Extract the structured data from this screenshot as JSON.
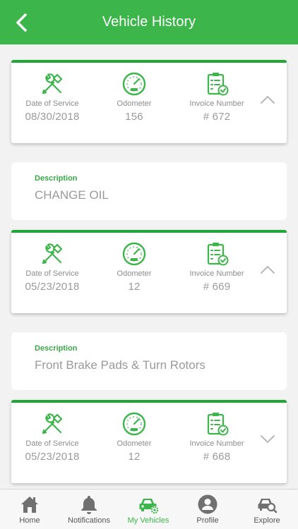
{
  "header": {
    "title": "Vehicle History"
  },
  "labels": {
    "date": "Date of Service",
    "odometer": "Odometer",
    "invoice": "Invoice Number",
    "description": "Description"
  },
  "records": [
    {
      "date": "08/30/2018",
      "odometer": "156",
      "invoice": "# 672",
      "expanded": true,
      "description": "CHANGE OIL"
    },
    {
      "date": "05/23/2018",
      "odometer": "12",
      "invoice": "# 669",
      "expanded": true,
      "description": "Front Brake Pads & Turn Rotors"
    },
    {
      "date": "05/23/2018",
      "odometer": "12",
      "invoice": "# 668",
      "expanded": false
    }
  ],
  "tabs": [
    {
      "label": "Home",
      "icon": "home-icon",
      "active": false
    },
    {
      "label": "Notifications",
      "icon": "bell-icon",
      "active": false
    },
    {
      "label": "My Vehicles",
      "icon": "car-gear-icon",
      "active": true
    },
    {
      "label": "Profile",
      "icon": "profile-icon",
      "active": false
    },
    {
      "label": "Explore",
      "icon": "car-search-icon",
      "active": false
    }
  ],
  "colors": {
    "brand": "#3cb54a",
    "accent_border": "#1fa637",
    "text_muted": "#9a9a9a"
  }
}
